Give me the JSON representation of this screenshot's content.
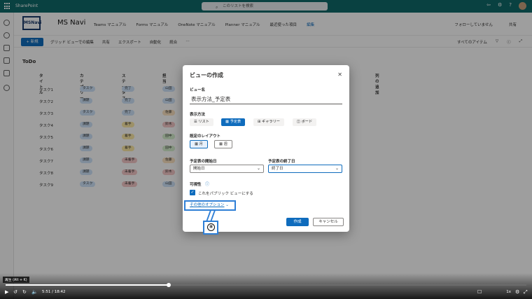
{
  "browser": {
    "app_name": "SharePoint",
    "search_placeholder": "このリストを検索"
  },
  "site": {
    "logo_text": "MSNavi",
    "name": "MS Navi",
    "nav": [
      "Teams マニュアル",
      "Forms マニュアル",
      "OneNote マニュアル",
      "Planner マニュアル",
      "最近使った項目"
    ],
    "nav_edit": "編集",
    "follow": "フォローしていません",
    "share": "共有"
  },
  "commandbar": {
    "new": "新規",
    "items": [
      "グリッド ビューでの編集",
      "共有",
      "エクスポート",
      "自動化",
      "統合"
    ],
    "more": "⋯",
    "view": "すべてのアイテム"
  },
  "list": {
    "title": "ToDo",
    "columns": [
      "タイトル",
      "カテゴリー",
      "ステータス",
      "担当",
      "列の追加"
    ],
    "rows": [
      {
        "title": "タスク1",
        "category": "タスク",
        "status": "完了",
        "owner": "山田"
      },
      {
        "title": "タスク2",
        "category": "課題",
        "status": "完了",
        "owner": "山田"
      },
      {
        "title": "タスク3",
        "category": "タスク",
        "status": "完了",
        "owner": "佐藤"
      },
      {
        "title": "タスク4",
        "category": "課題",
        "status": "着手",
        "owner": "鈴木"
      },
      {
        "title": "タスク5",
        "category": "課題",
        "status": "着手",
        "owner": "田中"
      },
      {
        "title": "タスク6",
        "category": "課題",
        "status": "着手",
        "owner": "田中"
      },
      {
        "title": "タスク7",
        "category": "課題",
        "status": "未着手",
        "owner": "佐藤"
      },
      {
        "title": "タスク8",
        "category": "課題",
        "status": "未着手",
        "owner": "鈴木"
      },
      {
        "title": "タスク9",
        "category": "タスク",
        "status": "未着手",
        "owner": "山田"
      }
    ],
    "colors": {
      "category": "#cfe4fa",
      "status_done": "#cfe4fa",
      "status_progress": "#fdeaa7",
      "status_todo": "#f6c9c9",
      "owner_a": "#cfe4fa",
      "owner_b": "#fde4c2",
      "owner_c": "#f6c9c9",
      "owner_d": "#d7f0cf"
    }
  },
  "dialog": {
    "title": "ビューの作成",
    "name_label": "ビュー名",
    "name_value": "表示方法_予定表",
    "show_as_label": "表示方法",
    "show_as": [
      "リスト",
      "予定表",
      "ギャラリー",
      "ボード"
    ],
    "show_as_selected": "予定表",
    "layout_label": "既定のレイアウト",
    "layouts": [
      "月",
      "週"
    ],
    "layout_selected": "月",
    "start_label": "予定表の開始日",
    "start_value": "開始日",
    "end_label": "予定表の終了日",
    "end_value": "終了日",
    "visibility_label": "可視性",
    "public_label": "これをパブリック ビューにする",
    "more_options": "その他のオプション",
    "create": "作成",
    "cancel": "キャンセル"
  },
  "annotation": {
    "step": "⑧"
  },
  "player": {
    "tooltip": "再生 (Alt + K)",
    "time": "5:51 / 18:42",
    "progress_fraction": 0.313,
    "speed": "1x"
  }
}
